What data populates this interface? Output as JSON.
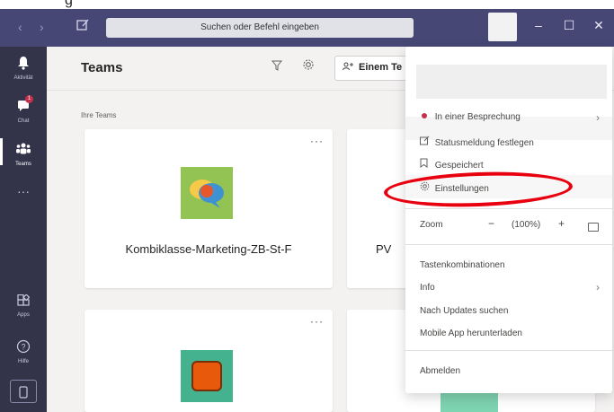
{
  "caption_top": "g",
  "titlebar": {
    "search_placeholder": "Suchen oder Befehl eingeben",
    "back_icon": "chevron-left",
    "forward_icon": "chevron-right",
    "compose_icon": "compose",
    "window": {
      "minimize": "–",
      "maximize": "☐",
      "close": "✕"
    }
  },
  "rail": {
    "items": [
      {
        "label": "Aktivität",
        "icon": "bell"
      },
      {
        "label": "Chat",
        "icon": "chat",
        "badge": "1"
      },
      {
        "label": "Teams",
        "icon": "teams"
      },
      {
        "label": "···",
        "icon": "more"
      },
      {
        "label": "Apps",
        "icon": "apps"
      },
      {
        "label": "Hilfe",
        "icon": "help"
      }
    ],
    "device_icon": "device"
  },
  "main": {
    "title": "Teams",
    "join_button": "Einem Te",
    "section_label": "Ihre Teams",
    "cards": [
      {
        "title": "Kombiklasse-Marketing-ZB-St-F",
        "more": "···"
      },
      {
        "title": "PV",
        "more": ""
      },
      {
        "title": "",
        "more": "···"
      },
      {
        "title": "",
        "more": ""
      }
    ]
  },
  "menu": {
    "status": "In einer Besprechung",
    "status_color": "#c4314b",
    "items": {
      "statusmeldung": "Statusmeldung festlegen",
      "gespeichert": "Gespeichert",
      "einstellungen": "Einstellungen",
      "zoom": "Zoom",
      "zoom_value": "(100%)",
      "zoom_minus": "−",
      "zoom_plus": "+",
      "tastenkombinationen": "Tastenkombinationen",
      "info": "Info",
      "updates": "Nach Updates suchen",
      "mobile": "Mobile App herunterladen",
      "abmelden": "Abmelden"
    }
  },
  "colors": {
    "titlebar": "#464775",
    "rail": "#33344a",
    "annotation": "#e8000f"
  }
}
